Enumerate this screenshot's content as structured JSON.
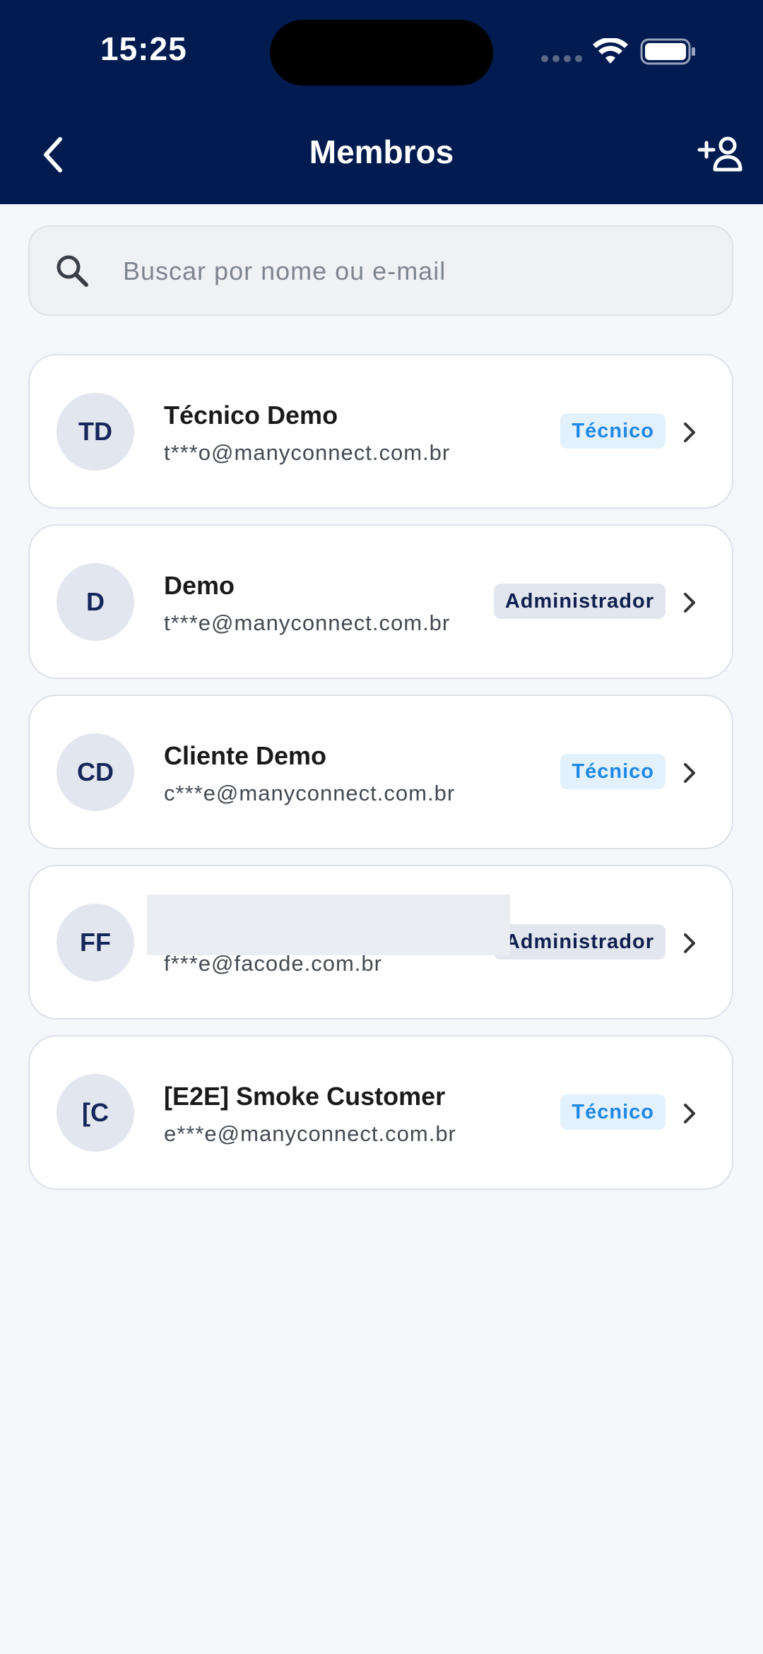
{
  "status_bar": {
    "time": "15:25"
  },
  "header": {
    "title": "Membros",
    "background": "#001B50",
    "back_icon": "chevron-left-icon",
    "add_icon": "add-person-icon"
  },
  "search": {
    "placeholder": "Buscar por nome ou e-mail",
    "icon": "search-icon"
  },
  "colors": {
    "tech_badge_bg": "#E3F1FD",
    "tech_badge_text": "#1E88E5",
    "admin_badge_bg": "#E2E6EE",
    "admin_badge_text": "#0F1F4E"
  },
  "members": [
    {
      "initials": "TD",
      "name": "Técnico Demo",
      "email": "t***o@manyconnect.com.br",
      "role": "Técnico"
    },
    {
      "initials": "D",
      "name": "Demo",
      "email": "t***e@manyconnect.com.br",
      "role": "Administrador"
    },
    {
      "initials": "CD",
      "name": "Cliente Demo",
      "email": "c***e@manyconnect.com.br",
      "role": "Técnico"
    },
    {
      "initials": "FF",
      "name": "",
      "email": "f***e@facode.com.br",
      "role": "Administrador"
    },
    {
      "initials": "[C",
      "name": "[E2E] Smoke Customer",
      "email": "e***e@manyconnect.com.br",
      "role": "Técnico"
    }
  ]
}
